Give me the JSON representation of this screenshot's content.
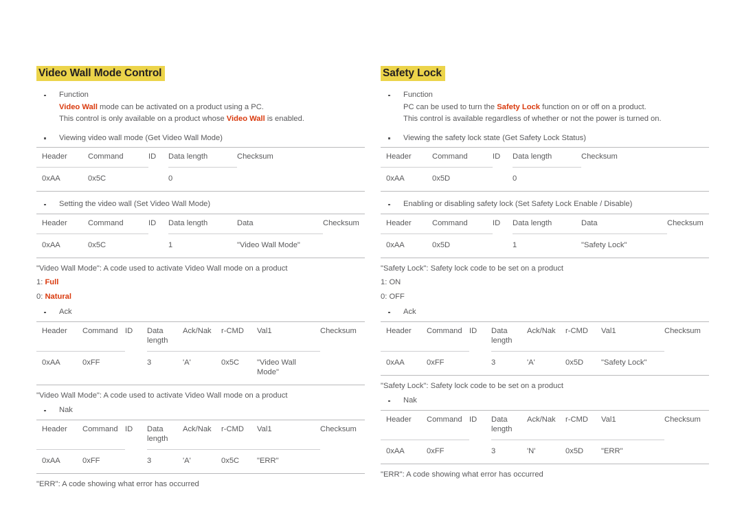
{
  "left": {
    "title": "Video Wall Mode Control",
    "function": {
      "label": "Function",
      "line1_pre": "",
      "line1_accent": "Video Wall",
      "line1_post": " mode can be activated on a product using a PC.",
      "line2_pre": "This control is only available on a product whose ",
      "line2_accent": "Video Wall",
      "line2_post": " is enabled."
    },
    "get": {
      "bullet": "Viewing video wall mode (Get Video Wall Mode)",
      "headers": [
        "Header",
        "Command",
        "ID",
        "Data length",
        "Checksum"
      ],
      "row": [
        "0xAA",
        "0x5C",
        "",
        "0",
        ""
      ]
    },
    "set": {
      "bullet": "Setting the video wall (Set Video Wall Mode)",
      "headers": [
        "Header",
        "Command",
        "ID",
        "Data length",
        "Data",
        "Checksum"
      ],
      "row": [
        "0xAA",
        "0x5C",
        "",
        "1",
        "\"Video Wall Mode\"",
        ""
      ]
    },
    "note1": "\"Video Wall Mode\": A code used to activate Video Wall mode on a product",
    "codes": [
      {
        "key": "1: ",
        "value": "Full",
        "red": true
      },
      {
        "key": "0: ",
        "value": "Natural",
        "red": true
      }
    ],
    "ack": {
      "bullet": "Ack",
      "headers": [
        "Header",
        "Command",
        "ID",
        "Data length",
        "Ack/Nak",
        "r-CMD",
        "Val1",
        "Checksum"
      ],
      "row": [
        "0xAA",
        "0xFF",
        "",
        "3",
        "'A'",
        "0x5C",
        "\"Video Wall Mode\"",
        ""
      ]
    },
    "note2": "\"Video Wall Mode\": A code used to activate Video Wall mode on a product",
    "nak": {
      "bullet": "Nak",
      "headers": [
        "Header",
        "Command",
        "ID",
        "Data length",
        "Ack/Nak",
        "r-CMD",
        "Val1",
        "Checksum"
      ],
      "row": [
        "0xAA",
        "0xFF",
        "",
        "3",
        "'A'",
        "0x5C",
        "\"ERR\"",
        ""
      ]
    },
    "note3": "\"ERR\": A code showing what error has occurred"
  },
  "right": {
    "title": "Safety Lock",
    "function": {
      "label": "Function",
      "line1_pre": "PC can be used to turn the ",
      "line1_accent": "Safety Lock",
      "line1_post": " function on or off on a product.",
      "line2": "This control is available regardless of whether or not the power is turned on."
    },
    "get": {
      "bullet": "Viewing the safety lock state (Get Safety Lock Status)",
      "headers": [
        "Header",
        "Command",
        "ID",
        "Data length",
        "Checksum"
      ],
      "row": [
        "0xAA",
        "0x5D",
        "",
        "0",
        ""
      ]
    },
    "set": {
      "bullet": "Enabling or disabling safety lock (Set Safety Lock Enable / Disable)",
      "headers": [
        "Header",
        "Command",
        "ID",
        "Data length",
        "Data",
        "Checksum"
      ],
      "row": [
        "0xAA",
        "0x5D",
        "",
        "1",
        "\"Safety Lock\"",
        ""
      ]
    },
    "note1": "\"Safety Lock\": Safety lock code to be set on a product",
    "codes": [
      {
        "key": "1: ",
        "value": "ON",
        "red": false
      },
      {
        "key": "0: ",
        "value": "OFF",
        "red": false
      }
    ],
    "ack": {
      "bullet": "Ack",
      "headers": [
        "Header",
        "Command",
        "ID",
        "Data length",
        "Ack/Nak",
        "r-CMD",
        "Val1",
        "Checksum"
      ],
      "row": [
        "0xAA",
        "0xFF",
        "",
        "3",
        "'A'",
        "0x5D",
        "\"Safety Lock\"",
        ""
      ]
    },
    "note2": "\"Safety Lock\": Safety lock code to be set on a product",
    "nak": {
      "bullet": "Nak",
      "headers": [
        "Header",
        "Command",
        "ID",
        "Data length",
        "Ack/Nak",
        "r-CMD",
        "Val1",
        "Checksum"
      ],
      "row": [
        "0xAA",
        "0xFF",
        "",
        "3",
        "'N'",
        "0x5D",
        "\"ERR\"",
        ""
      ]
    },
    "note3": "\"ERR\": A code showing what error has occurred"
  },
  "colors": {
    "highlight": "#ecd44a",
    "accent": "#d93a0e",
    "text": "#59595b",
    "rule": "#b9b9bb",
    "background": "#ffffff"
  }
}
